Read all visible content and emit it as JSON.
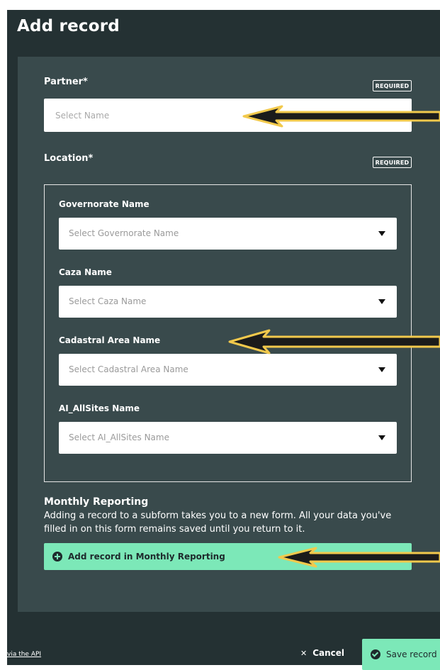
{
  "dialog": {
    "title": "Add record"
  },
  "partner": {
    "label": "Partner*",
    "required_badge": "REQUIRED",
    "placeholder": "Select Name"
  },
  "location": {
    "label": "Location*",
    "required_badge": "REQUIRED",
    "fields": [
      {
        "label": "Governorate Name",
        "placeholder": "Select Governorate Name"
      },
      {
        "label": "Caza Name",
        "placeholder": "Select Caza Name"
      },
      {
        "label": "Cadastral Area Name",
        "placeholder": "Select Cadastral Area Name"
      },
      {
        "label": "AI_AllSites Name",
        "placeholder": "Select AI_AllSites Name"
      }
    ]
  },
  "subform": {
    "title": "Monthly Reporting",
    "description": "Adding a record to a subform takes you to a new form. All your data you've filled in on this form remains saved until you return to it.",
    "add_button_label": "Add record in Monthly Reporting",
    "add_icon": "plus-circle-icon"
  },
  "footer": {
    "api_link": "via the API",
    "cancel_label": "Cancel",
    "cancel_icon": "close-icon",
    "save_label": "Save record",
    "save_icon": "check-circle-icon"
  },
  "colors": {
    "dialog_bg": "#243133",
    "panel_bg": "#394a4c",
    "accent": "#7ce8b8",
    "annotation_arrow": "#f2c94c"
  }
}
